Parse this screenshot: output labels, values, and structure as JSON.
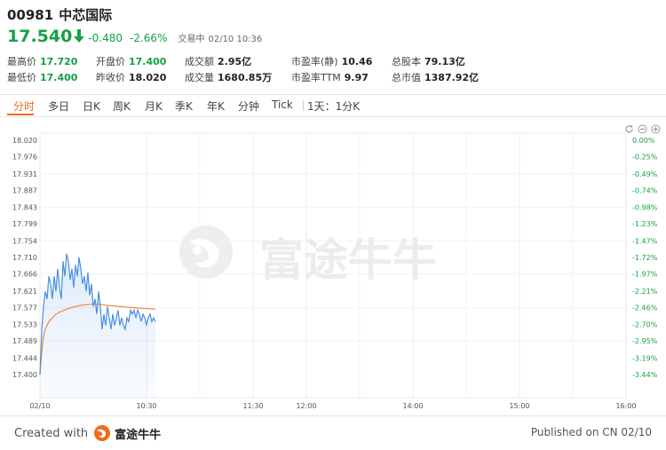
{
  "header": {
    "code": "00981",
    "name": "中芯国际",
    "price": "17.540",
    "change": "-0.480",
    "change_pct": "-2.66%",
    "trade_status": "交易中",
    "datetime": "02/10 10:36"
  },
  "stats": [
    {
      "label": "最高价",
      "value": "17.720",
      "green": true
    },
    {
      "label": "开盘价",
      "value": "17.400",
      "green": true
    },
    {
      "label": "成交额",
      "value": "2.95亿",
      "green": false
    },
    {
      "label": "市盈率(静)",
      "value": "10.46",
      "green": false
    },
    {
      "label": "总股本",
      "value": "79.13亿",
      "green": false
    },
    {
      "label": "最低价",
      "value": "17.400",
      "green": true
    },
    {
      "label": "昨收价",
      "value": "18.020",
      "green": false
    },
    {
      "label": "成交量",
      "value": "1680.85万",
      "green": false
    },
    {
      "label": "市盈率TTM",
      "value": "9.97",
      "green": false
    },
    {
      "label": "总市值",
      "value": "1387.92亿",
      "green": false
    }
  ],
  "tabs": [
    "分时",
    "多日",
    "日K",
    "周K",
    "月K",
    "季K",
    "年K",
    "分钟",
    "Tick",
    "1天：1分K"
  ],
  "active_tab": "分时",
  "watermark": "富途牛牛",
  "footer": {
    "created_with": "Created with",
    "brand": "富途牛牛",
    "published": "Published on CN 02/10"
  },
  "colors": {
    "down": "#16a047",
    "accent": "#f26b1c",
    "price_line": "#4a8fe0",
    "avg_line": "#f08a3c"
  },
  "chart_data": {
    "type": "line",
    "prev_close": 18.02,
    "y_ticks": [
      "18.020",
      "17.976",
      "17.931",
      "17.887",
      "17.843",
      "17.799",
      "17.754",
      "17.710",
      "17.666",
      "17.621",
      "17.577",
      "17.533",
      "17.489",
      "17.444",
      "17.400"
    ],
    "pct_ticks": [
      "0.00%",
      "-0.25%",
      "-0.49%",
      "-0.74%",
      "-0.98%",
      "-1.23%",
      "-1.47%",
      "-1.72%",
      "-1.97%",
      "-2.21%",
      "-2.46%",
      "-2.70%",
      "-2.95%",
      "-3.19%",
      "-3.44%"
    ],
    "ylim": [
      17.4,
      18.02
    ],
    "x_ticks": [
      {
        "label": "02/10",
        "minute": 0
      },
      {
        "label": "10:30",
        "minute": 60
      },
      {
        "label": "11:30",
        "minute": 120
      },
      {
        "label": "12:00",
        "minute": 150
      },
      {
        "label": "14:00",
        "minute": 210
      },
      {
        "label": "15:00",
        "minute": 270
      },
      {
        "label": "16:00",
        "minute": 330
      }
    ],
    "x_total_minutes": 330,
    "series": [
      {
        "key": "price",
        "values": [
          17.4,
          17.52,
          17.58,
          17.62,
          17.6,
          17.66,
          17.64,
          17.6,
          17.66,
          17.62,
          17.68,
          17.63,
          17.6,
          17.7,
          17.66,
          17.72,
          17.7,
          17.65,
          17.68,
          17.63,
          17.69,
          17.66,
          17.71,
          17.68,
          17.64,
          17.66,
          17.62,
          17.67,
          17.61,
          17.64,
          17.58,
          17.6,
          17.56,
          17.62,
          17.58,
          17.52,
          17.56,
          17.53,
          17.58,
          17.55,
          17.52,
          17.56,
          17.53,
          17.55,
          17.57,
          17.53,
          17.55,
          17.53,
          17.52,
          17.55,
          17.54,
          17.57,
          17.56,
          17.57,
          17.55,
          17.57,
          17.56,
          17.54,
          17.56,
          17.55,
          17.53,
          17.55,
          17.56,
          17.54,
          17.55,
          17.54
        ]
      },
      {
        "key": "average",
        "values": [
          17.4,
          17.46,
          17.5,
          17.52,
          17.53,
          17.54,
          17.545,
          17.55,
          17.555,
          17.56,
          17.562,
          17.565,
          17.567,
          17.569,
          17.571,
          17.573,
          17.575,
          17.576,
          17.578,
          17.579,
          17.58,
          17.581,
          17.582,
          17.583,
          17.584,
          17.584,
          17.585,
          17.585,
          17.586,
          17.586,
          17.586,
          17.586,
          17.586,
          17.586,
          17.585,
          17.585,
          17.584,
          17.584,
          17.583,
          17.583,
          17.582,
          17.582,
          17.581,
          17.581,
          17.58,
          17.58,
          17.58,
          17.579,
          17.579,
          17.578,
          17.578,
          17.578,
          17.577,
          17.577,
          17.577,
          17.576,
          17.576,
          17.576,
          17.575,
          17.575,
          17.575,
          17.574,
          17.574,
          17.574,
          17.573,
          17.573
        ]
      }
    ]
  }
}
